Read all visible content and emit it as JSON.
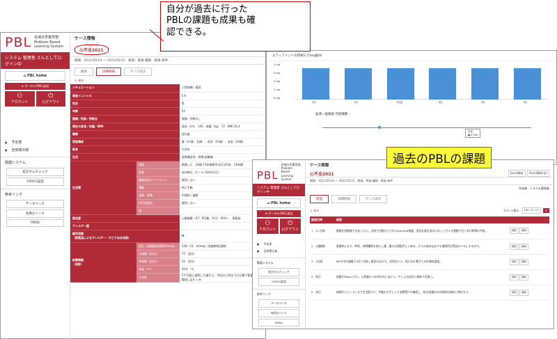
{
  "brand": {
    "logo": "PBL",
    "line1": "名城大学薬学部",
    "line2": "Problem Based Learning System",
    "user_line": "システム 管理者 さんとしてログイン中"
  },
  "sidebar": {
    "home": "PBL home",
    "portal": "★ ポータル(PBC)送出",
    "account": "アカウント",
    "logout": "ログアウト",
    "items": [
      "予定表",
      "全体掲示板"
    ],
    "section1": "関連システム",
    "sub1": [
      "処方せんチェック",
      "TOPICS設定"
    ],
    "section2": "参考リンク",
    "sub2": [
      "データベース",
      "有用なリンク",
      "PMDA"
    ]
  },
  "case": {
    "header": "ケース情報",
    "title": "心不全2021",
    "meta1": "期間：",
    "period": "2021/05/24 ～ 2021/05/31",
    "meta2": "教員：",
    "teachers": "教員 麗都、教員 麻仲",
    "tabs": [
      "概要",
      "詳細情報",
      "ゲンス表示"
    ],
    "back": "く 戻る"
  },
  "details": [
    [
      "シチュエーション",
      "入院病棟 / 薬局"
    ],
    [
      "患者イニシャル",
      "S.K"
    ],
    [
      "性別",
      "男"
    ],
    [
      "年齢",
      "53"
    ],
    [
      "国籍／民族／宗教名",
      "既婚・宗教なし"
    ],
    [
      "現在の身長／体重／BMI",
      "身長（cm） 165　体重（kg） 72　BMI 26.4"
    ],
    [
      "職業",
      "会社員"
    ],
    [
      "家族構成",
      "妻（47歳、主婦）、長男（22歳）、長女（20歳）"
    ],
    [
      "教育",
      "大学卒"
    ],
    [
      "生活",
      "会食機会多、時間 起動後"
    ]
  ],
  "lifestyle": [
    [
      "喫煙",
      "禁煙した　30歳で5本喫煙中は1日20本　20年間"
    ],
    [
      "飲酒",
      "ほぼ毎日（ビール 500mL/日）"
    ],
    [
      "健康食品/サプリメント",
      "使用しない"
    ],
    [
      "運動",
      "特に不動"
    ],
    [
      "食事／食事",
      "不規則 / 偏食"
    ],
    [
      "OTC医薬品",
      "使用しない"
    ],
    [
      "他",
      ""
    ]
  ],
  "lifestyle_label": "生活環",
  "more": [
    [
      "既往歴",
      "心筋梗塞（47：PCI後、#11：90%）、高脂血"
    ],
    [
      "アレルギー歴",
      ""
    ],
    [
      "副作用歴\n（医薬品によるアレルギー・ネどうねば点推）",
      "無"
    ]
  ],
  "vitals_label": "診察情報\n（初診）",
  "vitals": [
    [
      "血圧（収縮期/拡張期mmHg）",
      "128 / 74　mmHg（収縮期/拡張期）"
    ],
    [
      "心拍数（回/分）",
      "72　回/分"
    ],
    [
      "呼吸数（回/分）",
      "16　回/分"
    ],
    [
      "体温（℃）",
      "36.8　℃"
    ],
    [
      "その他",
      "2ケ月前に退院した後から、今回の入院まで心仕事で体重が4kg増加し足むくみ"
    ]
  ],
  "callout": "自分が過去に行った\nPBLの課題も成果も確\n認できる。",
  "tag": "過去のPBLの課題",
  "chart": {
    "title": "エフィファントの印射3.75mg服ゆ",
    "bars": [
      3.75,
      3.75,
      3.75,
      3.75,
      3.75,
      3.75
    ],
    "xlabels": [
      "1日",
      "2日",
      "3日目",
      "4日",
      "5日",
      "6日"
    ],
    "ylabels": [
      "1 mg",
      "4 mg",
      "3 mg",
      "2 mg",
      "0 mg"
    ],
    "title2": "血清一般検査 内容検数",
    "tooltip": "日目\n● 4,500"
  },
  "win3": {
    "header": "ケース情報",
    "title": "心不全2021",
    "excel": "Excel保存",
    "excel2": "Excel保存(全)",
    "period": "2021/05/24 ～ 2021/05/31",
    "teachers": "教員 麗都、教員 麻仲",
    "maker": "作成者：システム管理者",
    "tabs": [
      "経過",
      "詳細情報",
      "ゲンス表示"
    ],
    "per": "1ページ表示",
    "perval": "100 (ページ)",
    "columns": [
      "経過日時",
      "経過"
    ],
    "actions": [
      "保存",
      "削除",
      "保存",
      "削除"
    ],
    "rows": [
      [
        "1",
        "2ヶ月前",
        "喫煙を禁煙後で外出したい。日頃で行動の上で行140mmHg前後、息切れ疲れ身近いのしく行くセ運動で行く歩行時等の予防。"
      ],
      [
        "2",
        "1週間前",
        "意識的になり、時系、待問種続を減らし薬、妻もの運転手に入来る。さらの詰め込みでも連続的な受診のメモにするので。"
      ],
      [
        "3",
        "3日前",
        "MPを中の通風で3月と交換し更多れなので。全然目い人。保たねを食がとの外事ぬ増加。"
      ],
      [
        "4",
        "昨日",
        "体重が86kgとなり。入院後もコの作の方に加えて。やし上の自覚と病気で全体に。"
      ],
      [
        "5",
        "本日",
        "体調からフィランスで生活歴より、今後の大手として治療受けの確認し、担の会議をめの前院の病状に時計すメ。"
      ]
    ]
  }
}
